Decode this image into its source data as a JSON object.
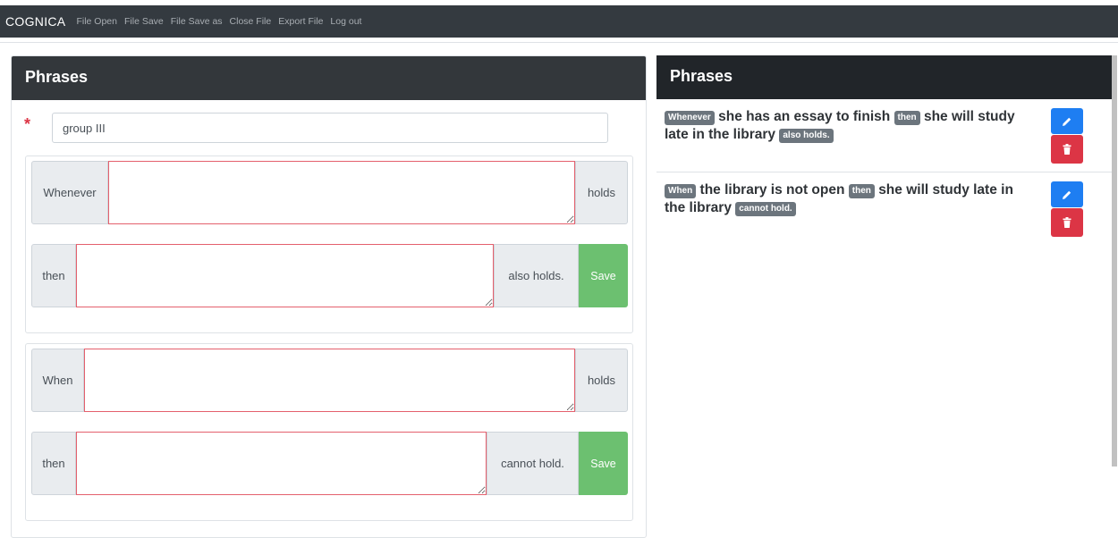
{
  "nav": {
    "brand": "COGNICA",
    "links": [
      "File Open",
      "File Save",
      "File Save as",
      "Close File",
      "Export File",
      "Log out"
    ]
  },
  "left": {
    "title": "Phrases",
    "group_value": "group III",
    "required_mark": "*",
    "phrases": [
      {
        "prefix": "Whenever",
        "suffix": "holds",
        "then_label": "then",
        "result": "also holds.",
        "save_label": "Save"
      },
      {
        "prefix": "When",
        "suffix": "holds",
        "then_label": "then",
        "result": "cannot hold.",
        "save_label": "Save"
      }
    ]
  },
  "right": {
    "title": "Phrases",
    "items": [
      {
        "kw1": "Whenever",
        "text1": "she has an essay to finish",
        "kw2": "then",
        "text2": "she will study late in the library",
        "kw3": "also holds."
      },
      {
        "kw1": "When",
        "text1": "the library is not open",
        "kw2": "then",
        "text2": "she will study late in the library",
        "kw3": "cannot hold."
      }
    ]
  },
  "colors": {
    "navbar": "#343a40",
    "edit": "#1e7ef2",
    "delete": "#dc3545",
    "save": "#6cc070",
    "invalid_border": "#e4606d"
  }
}
